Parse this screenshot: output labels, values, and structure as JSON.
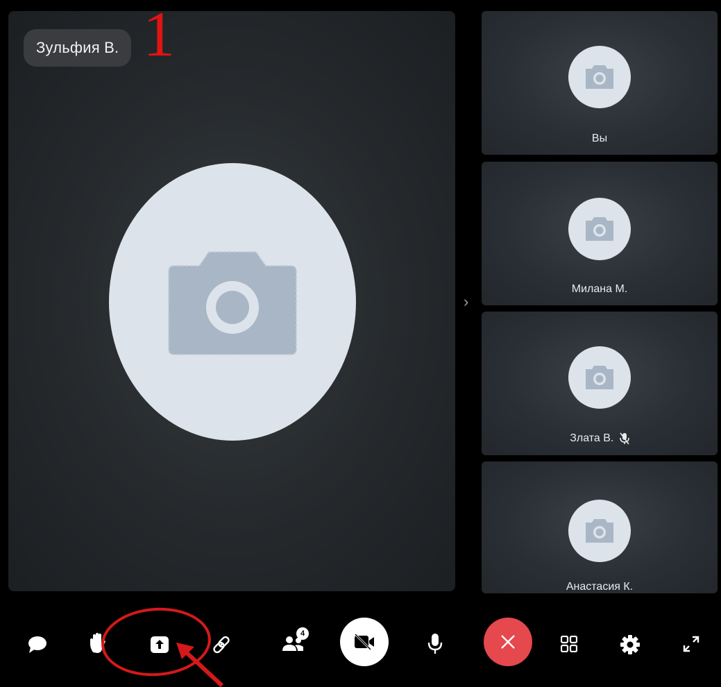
{
  "main_participant": {
    "name": "Зульфия В."
  },
  "annotation": {
    "number": "1"
  },
  "sidebar": {
    "participants": [
      {
        "name": "Вы",
        "muted": false
      },
      {
        "name": "Милана М.",
        "muted": false
      },
      {
        "name": "Злата В.",
        "muted": true
      },
      {
        "name": "Анастасия К.",
        "muted": false
      }
    ]
  },
  "toolbar": {
    "participants_count": "4",
    "items": [
      "chat-icon",
      "raise-hand-icon",
      "share-screen-icon",
      "link-icon",
      "participants-icon",
      "camera-off-icon",
      "microphone-icon",
      "hang-up-icon",
      "grid-layout-icon",
      "settings-icon",
      "fullscreen-icon"
    ]
  },
  "colors": {
    "hang_up": "#e5484d",
    "annotation": "#e01414",
    "avatar": "#dde3ea",
    "camera_glyph": "#a9b6c6"
  }
}
